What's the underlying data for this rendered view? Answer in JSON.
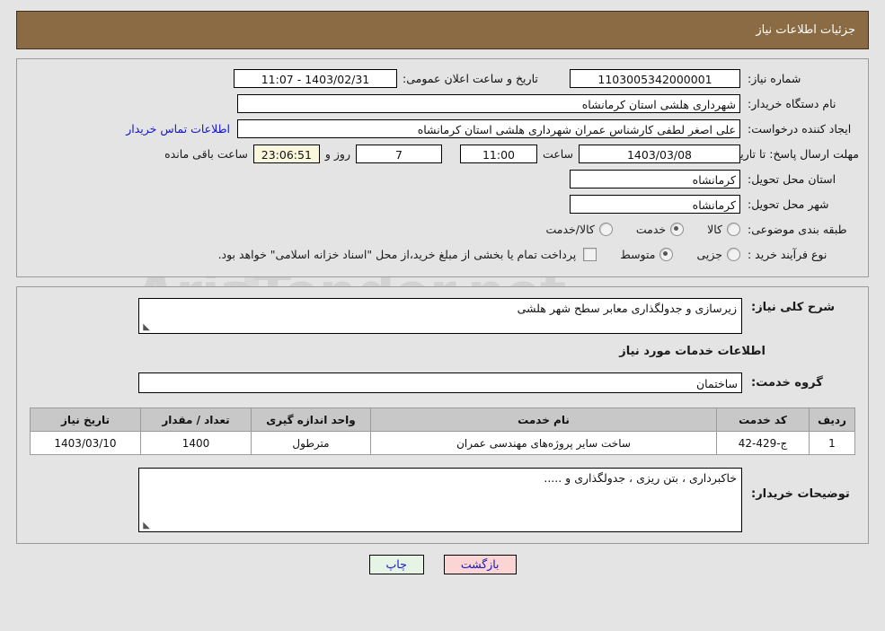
{
  "header": {
    "title": "جزئیات اطلاعات نیاز"
  },
  "form": {
    "need_number_label": "شماره نیاز:",
    "need_number_value": "1103005342000001",
    "announce_label": "تاریخ و ساعت اعلان عمومی:",
    "announce_value": "1403/02/31 - 11:07",
    "buyer_org_label": "نام دستگاه خریدار:",
    "buyer_org_value": "شهرداری هلشی استان کرمانشاه",
    "creator_label": "ایجاد کننده درخواست:",
    "creator_value": "علی اصغر  لطفی کارشناس عمران شهرداری هلشی استان کرمانشاه",
    "creator_org_value": "شهرداری هلشی استان کرمانشاه",
    "contact_link": "اطلاعات تماس خریدار",
    "deadline_label": "مهلت ارسال پاسخ: تا تاریخ:",
    "deadline_date": "1403/03/08",
    "hour_word": "ساعت",
    "deadline_time": "11:00",
    "days_value": "7",
    "days_word": "روز و",
    "countdown_value": "23:06:51",
    "remaining_word": "ساعت باقی مانده",
    "province_label": "استان محل تحویل:",
    "province_value": "کرمانشاه",
    "city_label": "شهر محل تحویل:",
    "city_value": "کرمانشاه",
    "category_label": "طبقه بندی موضوعی:",
    "category_options": [
      {
        "label": "کالا",
        "selected": false
      },
      {
        "label": "خدمت",
        "selected": true
      },
      {
        "label": "کالا/خدمت",
        "selected": false
      }
    ],
    "process_label": "نوع فرآیند خرید :",
    "process_options": [
      {
        "label": "جزیی",
        "selected": false
      },
      {
        "label": "متوسط",
        "selected": true
      }
    ],
    "treasury_checkbox_checked": false,
    "treasury_note": "پرداخت تمام یا بخشی از مبلغ خرید،از محل \"اسناد خزانه اسلامی\" خواهد بود."
  },
  "description": {
    "general_label": "شرح کلی نیاز:",
    "general_value": "زیرسازی و جدولگذاری معابر سطح شهر هلشی",
    "section_title": "اطلاعات خدمات مورد نیاز",
    "service_group_label": "گروه خدمت:",
    "service_group_value": "ساختمان"
  },
  "table": {
    "columns": [
      "ردیف",
      "کد خدمت",
      "نام خدمت",
      "واحد اندازه گیری",
      "تعداد / مقدار",
      "تاریخ نیاز"
    ],
    "rows": [
      {
        "row_no": "1",
        "service_code": "ج-429-42",
        "service_name": "ساخت سایر پروژه‌های مهندسی عمران",
        "unit": "مترطول",
        "quantity": "1400",
        "need_date": "1403/03/10"
      }
    ]
  },
  "notes": {
    "label": "توضیحات خریدار:",
    "value": "خاکبرداری ، بتن ریزی ، جدولگذاری و ....."
  },
  "buttons": {
    "print": "چاپ",
    "back": "بازگشت"
  },
  "colors": {
    "header_bar": "#8b6b43",
    "link": "#1414c8",
    "timer_bg": "#faf8dc",
    "print_bg": "#e6f4e6",
    "back_bg": "#fbd4d4",
    "table_header_bg": "#c8c8c8"
  }
}
